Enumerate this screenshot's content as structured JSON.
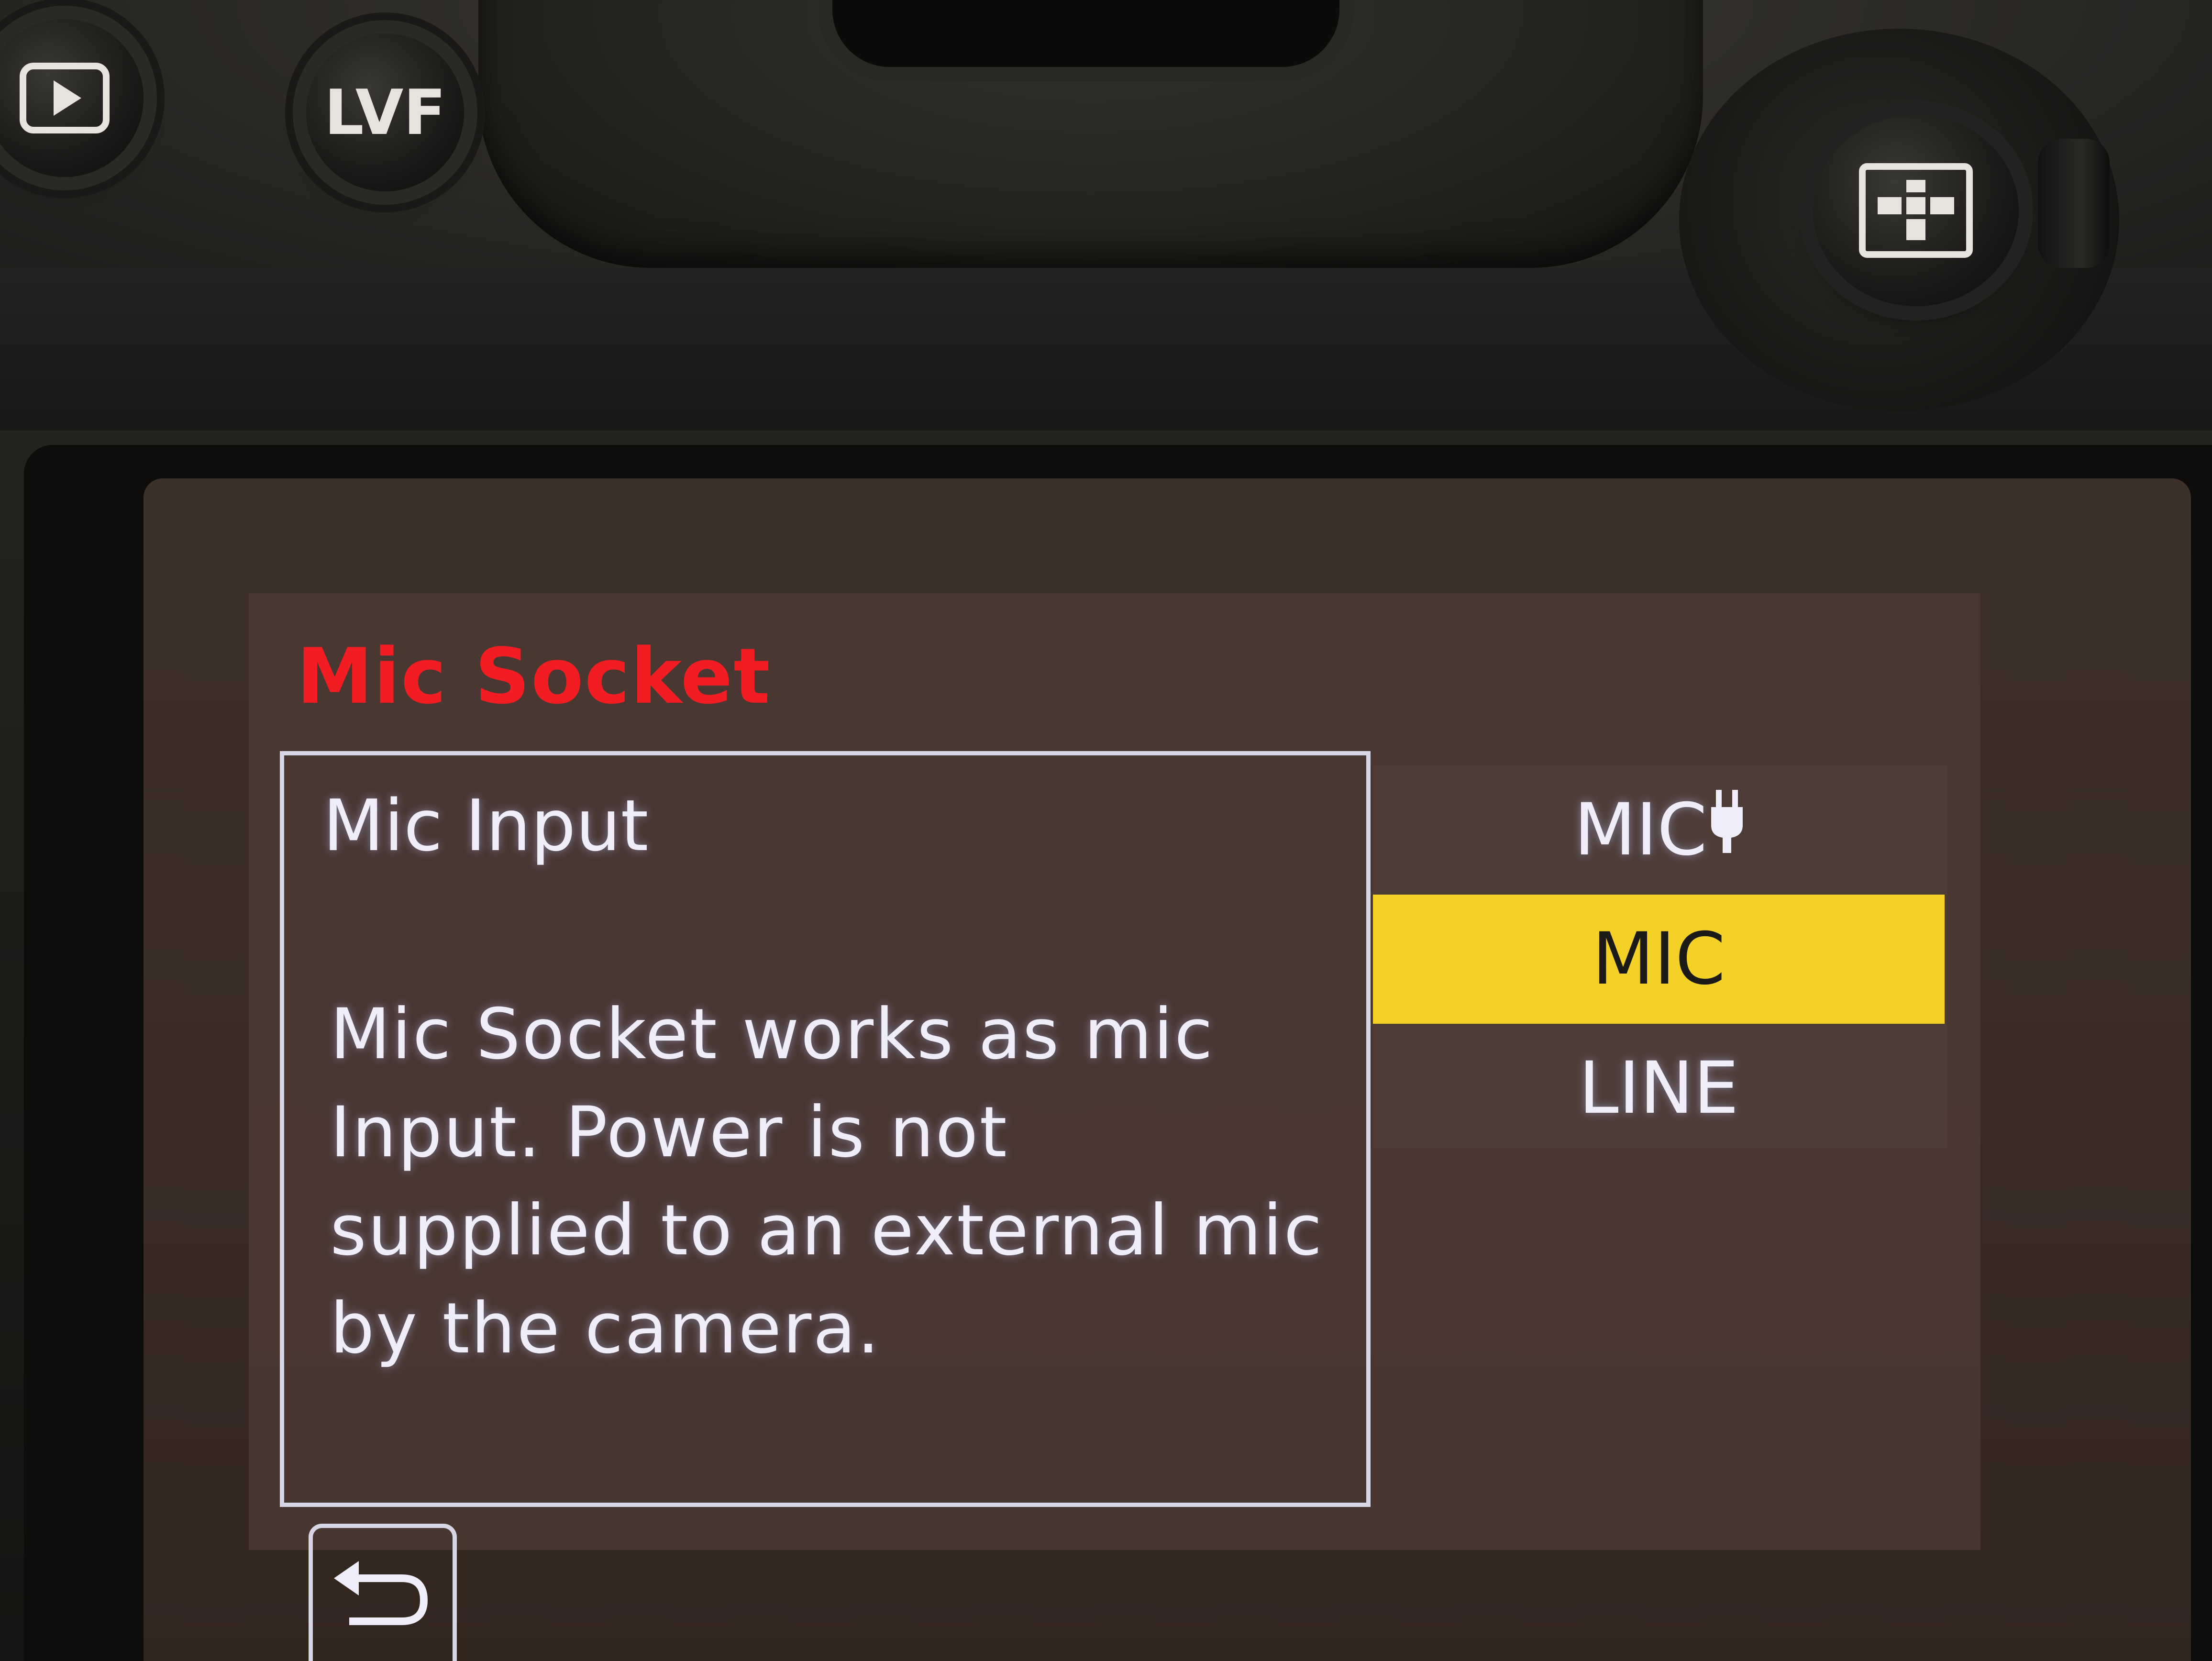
{
  "camera": {
    "play_button_icon": "play-icon",
    "lvf_label": "LVF",
    "grid_button_icon": "q-menu-grid-icon"
  },
  "screen": {
    "title": "Mic Socket",
    "title_color": "#f21d22",
    "help": {
      "heading": "Mic Input",
      "description": "Mic Socket works as mic Input. Power is not supplied to an external mic by the camera."
    },
    "options": [
      {
        "label": "MIC",
        "icon": "plug-in-power-icon",
        "selected": false
      },
      {
        "label": "MIC",
        "selected": true
      },
      {
        "label": "LINE",
        "selected": false
      }
    ],
    "selected_highlight_color": "#f4d126",
    "back_icon": "return-arrow-icon"
  }
}
